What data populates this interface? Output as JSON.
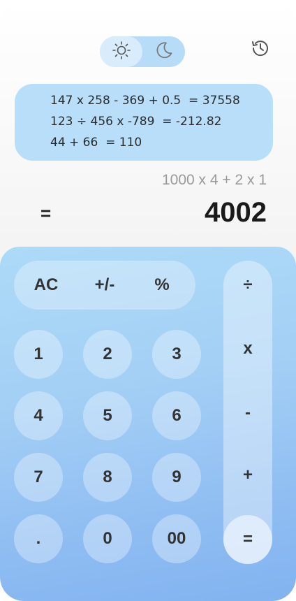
{
  "theme_toggle": {
    "light_icon": "sun-icon",
    "dark_icon": "moon-icon",
    "active": "light"
  },
  "history_icon": "history-clock-icon",
  "history": [
    "147 x 258 - 369 + 0.5  = 37558",
    "123 ÷ 456 x -789  = -212.82",
    "44 + 66  = 110"
  ],
  "display": {
    "expression": "1000 x 4 + 2 x 1",
    "equals_sign": "=",
    "result": "4002"
  },
  "keys": {
    "function": [
      "AC",
      "+/-",
      "%"
    ],
    "digits": [
      "1",
      "2",
      "3",
      "4",
      "5",
      "6",
      "7",
      "8",
      "9",
      ".",
      "0",
      "00"
    ],
    "operators": [
      "÷",
      "x",
      "-",
      "+",
      "="
    ]
  },
  "colors": {
    "accent_light": "#b8defa",
    "keypad_top": "#aedaf8",
    "keypad_bottom": "#82b3f0"
  }
}
